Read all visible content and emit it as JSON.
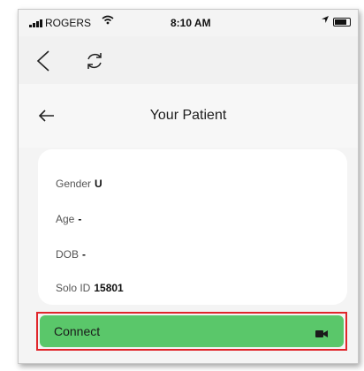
{
  "status_bar": {
    "carrier": "ROGERS",
    "time": "8:10 AM"
  },
  "browser": {
    "back_icon": "chevron-left-icon",
    "refresh_icon": "refresh-icon"
  },
  "header": {
    "title": "Your Patient",
    "back_icon": "arrow-left-icon"
  },
  "patient": {
    "gender_label": "Gender",
    "gender_value": "U",
    "age_label": "Age",
    "age_value": "-",
    "dob_label": "DOB",
    "dob_value": "-",
    "solo_id_label": "Solo ID",
    "solo_id_value": "15801"
  },
  "connect_button": {
    "label": "Connect",
    "icon": "video-camera-icon",
    "highlight_color": "#e0262b",
    "color": "#5ac76a"
  }
}
